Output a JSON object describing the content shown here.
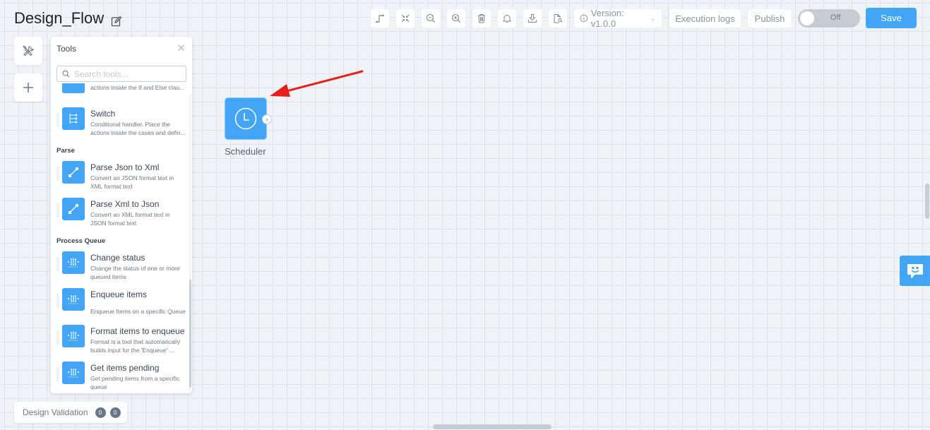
{
  "header": {
    "title": "Design_Flow",
    "edit_icon": "edit-icon"
  },
  "toolbar": {
    "icons": [
      "connector-icon",
      "fit-screen-icon",
      "zoom-out-icon",
      "zoom-in-icon",
      "trash-icon",
      "bell-icon",
      "download-icon",
      "file-search-icon"
    ],
    "version_label": "Version: v1.0.0",
    "execution_logs_label": "Execution logs",
    "publish_label": "Publish",
    "toggle_label": "Off",
    "toggle_on": false,
    "save_label": "Save"
  },
  "sidebar": {
    "tools_icon": "tools-icon",
    "add_icon": "plus-icon"
  },
  "tools_panel": {
    "title": "Tools",
    "search_placeholder": "Search tools...",
    "search_value": "",
    "partial_item_desc": "Conditional handler. Place the actions inside the If and Else clau...",
    "items_before": [
      {
        "name": "Switch",
        "desc": "Conditional handler. Place the actions inside the cases and defin...",
        "icon": "switch-icon"
      }
    ],
    "sections": [
      {
        "label": "Parse",
        "items": [
          {
            "name": "Parse Json to Xml",
            "desc": "Convert an JSON format text in XML format text",
            "icon": "parse-icon"
          },
          {
            "name": "Parse Xml to Json",
            "desc": "Convert an XML format text in JSON format text",
            "icon": "parse-icon"
          }
        ]
      },
      {
        "label": "Process Queue",
        "items": [
          {
            "name": "Change status",
            "desc": "Change the status of one or more queued items",
            "icon": "queue-icon"
          },
          {
            "name": "Enqueue items",
            "desc": "Enqueue Items on a specific Queue",
            "icon": "queue-icon"
          },
          {
            "name": "Format items to enqueue",
            "desc": "Format is a tool that automatically builds input for the 'Enqueue' ...",
            "icon": "queue-icon"
          },
          {
            "name": "Get items pending",
            "desc": "Get pending items from a specific queue",
            "icon": "queue-icon"
          }
        ]
      }
    ]
  },
  "canvas": {
    "nodes": [
      {
        "label": "Scheduler",
        "icon": "clock-icon"
      }
    ],
    "annotation": "red-arrow pointing at Scheduler node"
  },
  "validation": {
    "label": "Design Validation",
    "errors": "0",
    "warnings": "0"
  },
  "colors": {
    "accent": "#42a5f5",
    "canvas_bg": "#f0f3f8",
    "arrow": "#e8201c",
    "toggle_off": "#c5cdd3"
  }
}
